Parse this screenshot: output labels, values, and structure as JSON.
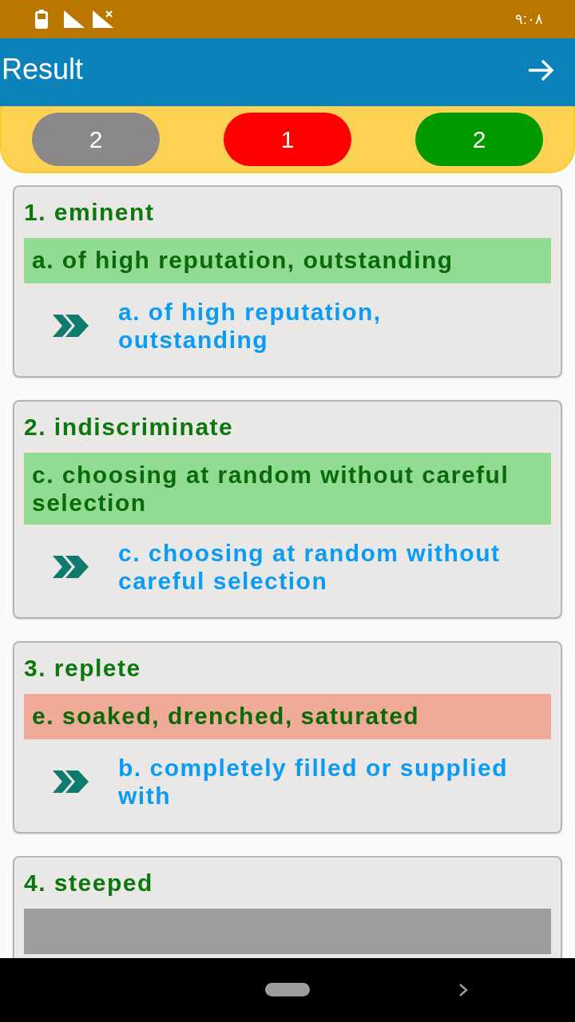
{
  "status_bar": {
    "time": "٩:٠٨"
  },
  "app_bar": {
    "title": "Result"
  },
  "summary": [
    {
      "kind": "unanswered",
      "count": "2"
    },
    {
      "kind": "wrong",
      "count": "1"
    },
    {
      "kind": "correct",
      "count": "2"
    }
  ],
  "questions": [
    {
      "title": "1. eminent",
      "kind": "correct",
      "chosen": "a. of high reputation, outstanding",
      "correct_answer": "a. of high reputation, outstanding"
    },
    {
      "title": "2. indiscriminate",
      "kind": "correct",
      "chosen": "c. choosing at random without careful selection",
      "correct_answer": "c. choosing at random without careful selection"
    },
    {
      "title": "3. replete",
      "kind": "wrong",
      "chosen": "e. soaked, drenched, saturated",
      "correct_answer": "b. completely filled or supplied with"
    },
    {
      "title": "4. steeped",
      "kind": "unanswered"
    }
  ]
}
